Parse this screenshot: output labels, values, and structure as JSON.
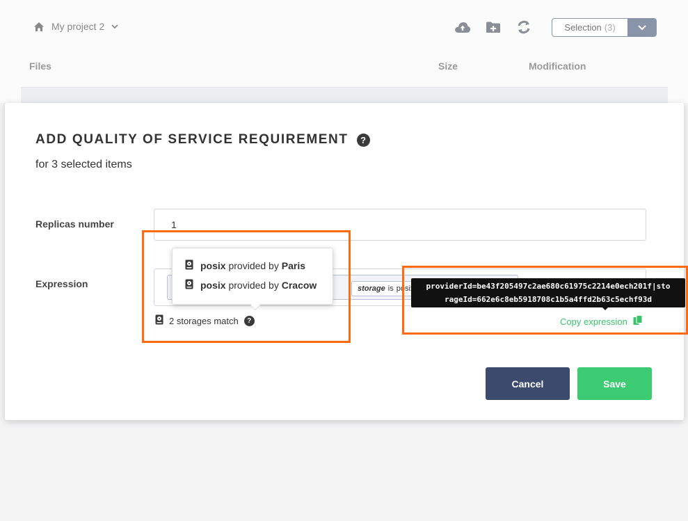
{
  "header": {
    "breadcrumb_label": "My project 2",
    "toolbar_icons": [
      "cloud-upload-icon",
      "folder-add-icon",
      "refresh-icon"
    ],
    "selection_label": "Selection",
    "selection_count": "(3)"
  },
  "table": {
    "columns": [
      "Files",
      "Size",
      "Modification"
    ]
  },
  "modal": {
    "title": "ADD QUALITY OF SERVICE REQUIREMENT",
    "subtitle": "for 3 selected items",
    "replicas_label": "Replicas number",
    "replicas_value": "1",
    "expression_label": "Expression",
    "expression_token": {
      "key": "storage",
      "op": "is",
      "value": "posix"
    },
    "matching_text": "2 storages match",
    "storages": [
      {
        "name": "posix",
        "connector": "provided by",
        "provider": "Paris"
      },
      {
        "name": "posix",
        "connector": "provided by",
        "provider": "Cracow"
      }
    ],
    "copy_label": "Copy expression",
    "tooltip_line1": "providerId=be43f205497c2ae680c61975c2214e0ech201f|sto",
    "tooltip_line2": "rageId=662e6c8eb5918708c1b5a4ffd2b63c5echf93d",
    "cancel_label": "Cancel",
    "save_label": "Save"
  },
  "colors": {
    "highlight": "#ff6a13",
    "save": "#3ccb73",
    "cancel": "#3c4a6d",
    "copy_link": "#39c46b"
  }
}
